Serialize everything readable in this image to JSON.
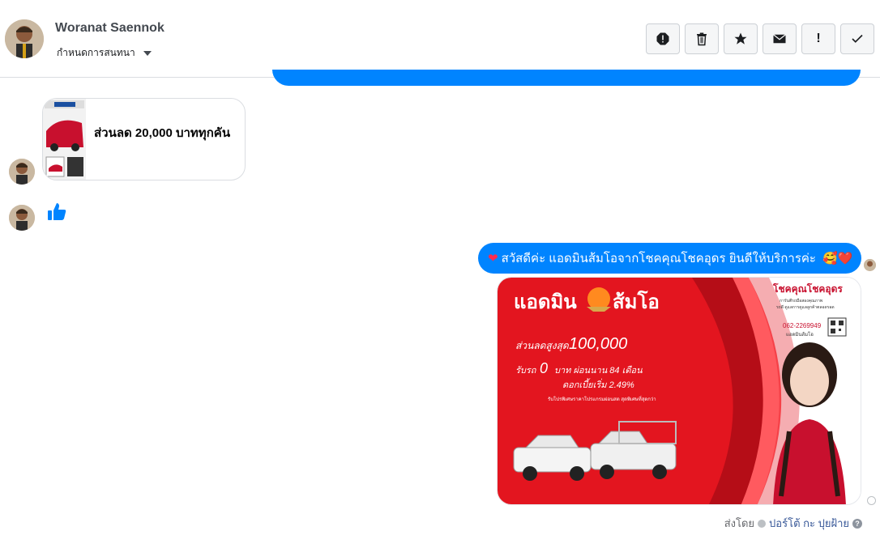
{
  "header": {
    "contact_name": "Woranat Saennok",
    "label_dropdown": "กำหนดการสนทนา",
    "toolbar": {
      "icons": [
        "report-icon",
        "trash-icon",
        "star-icon",
        "envelope-icon",
        "exclamation-icon",
        "check-icon"
      ],
      "exclamation_text": "!"
    }
  },
  "messages": {
    "card": {
      "title": "ส่วนลด 20,000 บาททุกคัน"
    },
    "outgoing_text": "สวัสดีค่ะ แอดมินส้มโอจากโชคคุณโชคอุดร ยินดีให้บริการค่ะ",
    "emoji_end": "🥰❤️",
    "promo": {
      "brand": "แอดมิน",
      "brand2": "ส้มโอ",
      "company": "โชคคุณโชคอุดร",
      "company_sub1": "การันตีรถมือสองคุณภาพ",
      "company_sub2": "รถดี ดูแลการดูแลลูกค้าตลอดรอด",
      "phone": "062-2269949",
      "contact_name": "แอดมินส้มโอ",
      "discount_label": "ส่วนลดสูงสุด",
      "discount_value": "100,000",
      "line2a": "รับรถ",
      "line2b": "0",
      "line2c": "บาท ผ่อนนาน 84 เดือน",
      "line3": "ดอกเบี้ยเริ่ม 2.49%",
      "line4": "รับโปรพิเศษราคาโปรแกรมผ่อนสด สุดพิเศษที่สุดกว่า"
    }
  },
  "footer": {
    "sent_by_label": "ส่งโดย",
    "sender_name": "ปอร์โต้ กะ ปุยฝ้าย",
    "help": "?"
  },
  "colors": {
    "messenger_blue": "#0084ff",
    "promo_red": "#e3151f"
  }
}
